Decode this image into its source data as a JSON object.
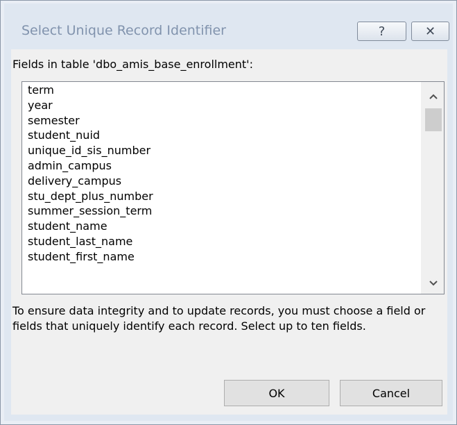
{
  "window": {
    "title": "Select Unique Record Identifier",
    "help_glyph": "?",
    "close_glyph": "✕"
  },
  "fields_label": "Fields in table 'dbo_amis_base_enrollment':",
  "fields": [
    "term",
    "year",
    "semester",
    "student_nuid",
    "unique_id_sis_number",
    "admin_campus",
    "delivery_campus",
    "stu_dept_plus_number",
    "summer_session_term",
    "student_name",
    "student_last_name",
    "student_first_name"
  ],
  "note": "To ensure data integrity and to update records, you must choose a field or fields that uniquely identify each record. Select up to ten fields.",
  "buttons": {
    "ok": "OK",
    "cancel": "Cancel"
  },
  "icons": {
    "scroll_up": "chevron-up-icon",
    "scroll_down": "chevron-down-icon",
    "help": "question-mark-icon",
    "close": "close-icon"
  }
}
